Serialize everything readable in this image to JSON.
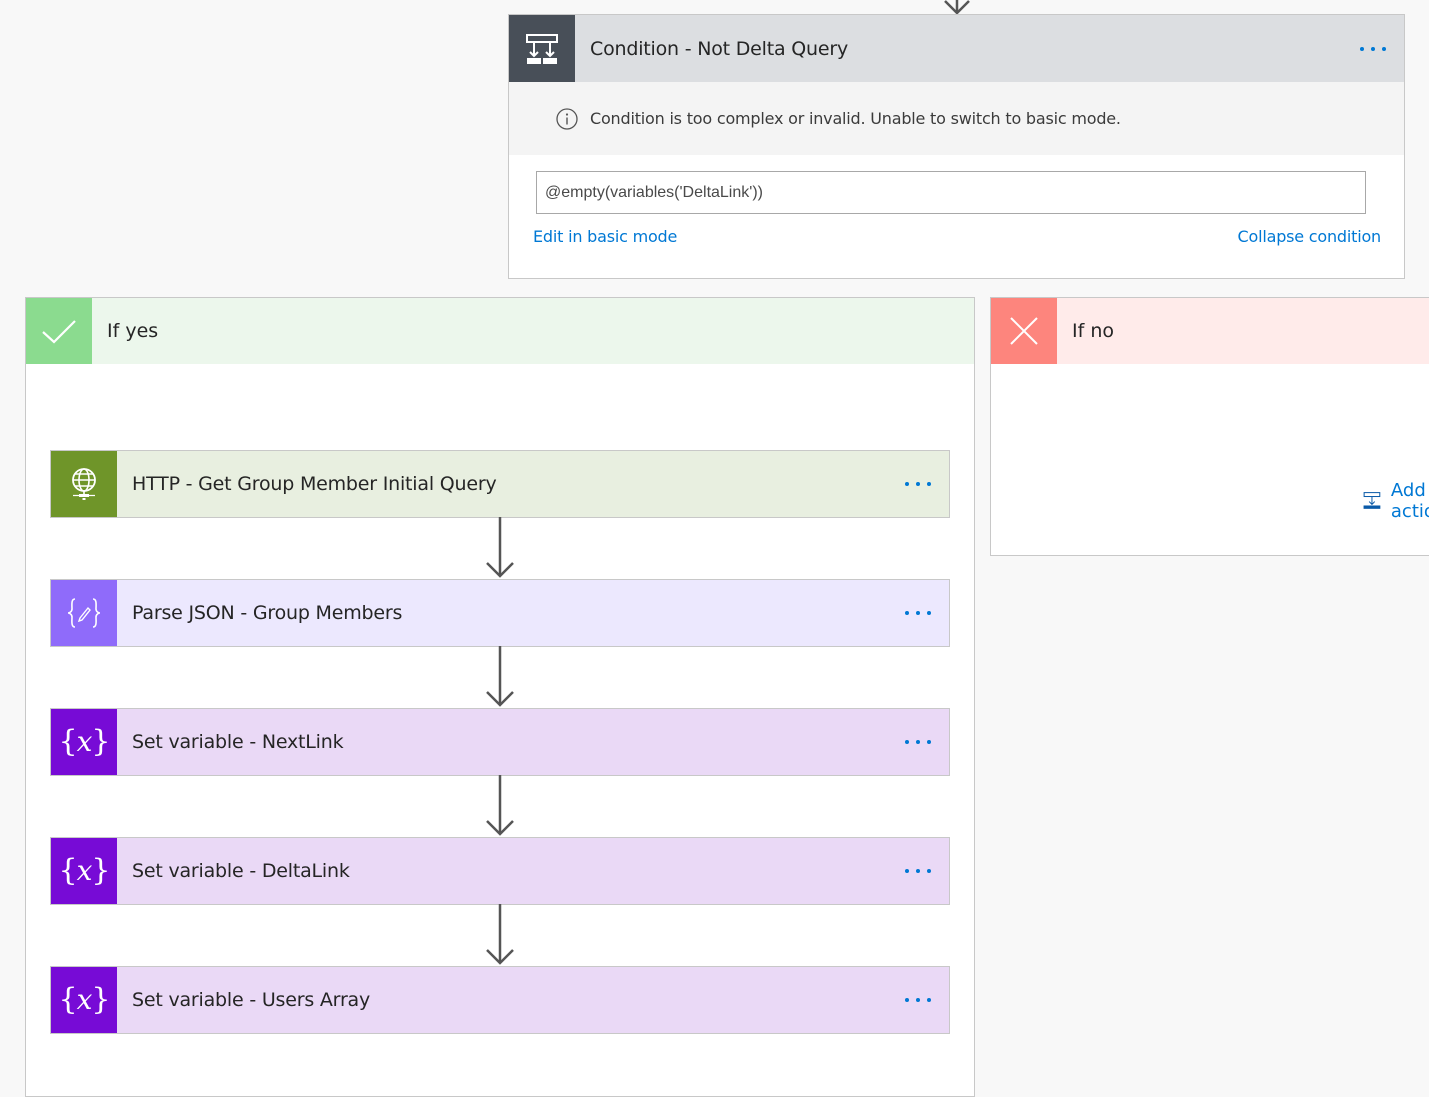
{
  "condition": {
    "title": "Condition - Not Delta Query",
    "icon": "condition-icon",
    "info_message": "Condition is too complex or invalid. Unable to switch to basic mode.",
    "expression": "@empty(variables('DeltaLink'))",
    "edit_basic_label": "Edit in basic mode",
    "collapse_label": "Collapse condition"
  },
  "branches": {
    "yes": {
      "label": "If yes",
      "icon": "checkmark-icon",
      "color": "#8bdb8f"
    },
    "no": {
      "label": "If no",
      "icon": "close-icon",
      "color": "#fd857d",
      "add_action_label": "Add an action"
    }
  },
  "actions": [
    {
      "title": "HTTP - Get Group Member Initial Query",
      "icon": "globe-icon",
      "color": "#6f9529"
    },
    {
      "title": "Parse JSON - Group Members",
      "icon": "parse-json-icon",
      "color": "#8f6bfa"
    },
    {
      "title": "Set variable - NextLink",
      "icon": "variable-icon",
      "color": "#770bd6"
    },
    {
      "title": "Set variable - DeltaLink",
      "icon": "variable-icon",
      "color": "#770bd6"
    },
    {
      "title": "Set variable - Users Array",
      "icon": "variable-icon",
      "color": "#770bd6"
    }
  ],
  "colors": {
    "link": "#0078d4",
    "canvas": "#f8f8f8"
  }
}
